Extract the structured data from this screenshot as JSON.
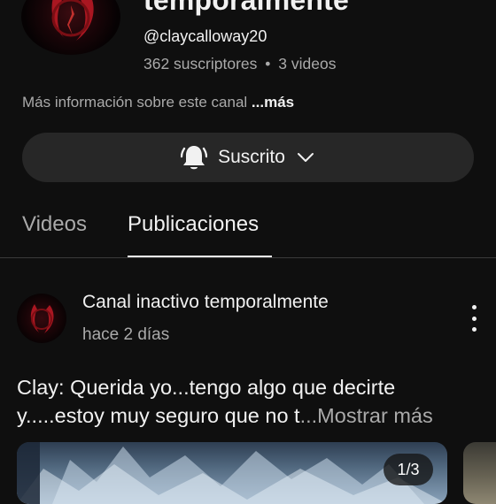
{
  "channel": {
    "title": "temporalmente",
    "handle": "@claycalloway20",
    "subscribers": "362 suscriptores",
    "separator": "•",
    "videos": "3 videos",
    "about_text": "Más información sobre este canal",
    "about_more": "...más",
    "avatar_icon": "channel-avatar-image"
  },
  "subscribe": {
    "label": "Suscrito",
    "bell_icon": "bell-notification-icon",
    "chevron_icon": "chevron-down-icon"
  },
  "tabs": [
    {
      "label": "Videos",
      "active": false
    },
    {
      "label": "Publicaciones",
      "active": true
    }
  ],
  "post": {
    "author": "Canal inactivo temporalmente",
    "time": "hace 2 días",
    "text_line1": "Clay: Querida yo...tengo algo que decirte",
    "text_line2": "y.....estoy muy seguro que no t",
    "show_more": "...Mostrar más",
    "image_counter": "1/3",
    "menu_icon": "more-vertical-icon"
  },
  "colors": {
    "background": "#0f0f0f",
    "text": "#f1f1f1",
    "secondary_text": "#aaaaaa",
    "button_bg": "#272727",
    "avatar_accent": "#c21a26"
  }
}
